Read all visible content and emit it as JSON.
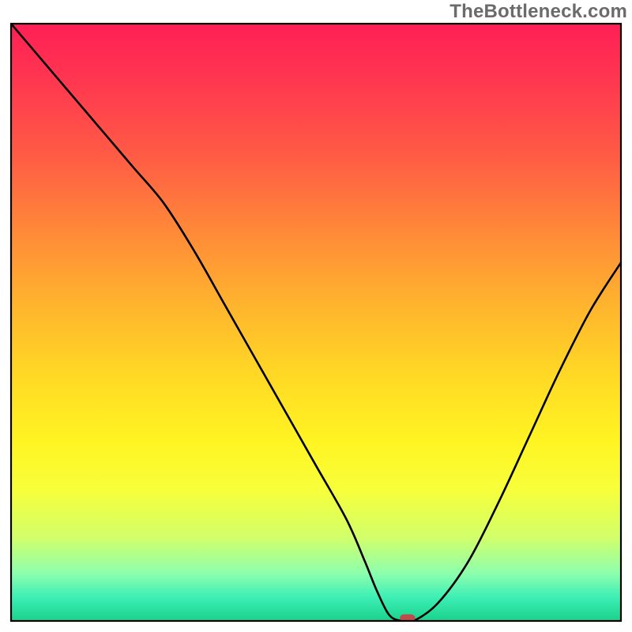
{
  "watermark": "TheBottleneck.com",
  "chart_data": {
    "type": "line",
    "title": "",
    "xlabel": "",
    "ylabel": "",
    "xlim": [
      0,
      100
    ],
    "ylim": [
      0,
      100
    ],
    "grid": false,
    "legend": false,
    "background_gradient": {
      "stops": [
        {
          "offset": 0.0,
          "color": "#ff1f55"
        },
        {
          "offset": 0.1,
          "color": "#ff3850"
        },
        {
          "offset": 0.22,
          "color": "#ff5b45"
        },
        {
          "offset": 0.35,
          "color": "#ff8a38"
        },
        {
          "offset": 0.48,
          "color": "#ffb72d"
        },
        {
          "offset": 0.6,
          "color": "#ffdc24"
        },
        {
          "offset": 0.7,
          "color": "#fff423"
        },
        {
          "offset": 0.78,
          "color": "#f7ff3a"
        },
        {
          "offset": 0.86,
          "color": "#d2ff6a"
        },
        {
          "offset": 0.92,
          "color": "#8dffad"
        },
        {
          "offset": 0.96,
          "color": "#3eefb5"
        },
        {
          "offset": 1.0,
          "color": "#19d28c"
        }
      ]
    },
    "series": [
      {
        "name": "bottleneck-curve",
        "x": [
          0,
          5,
          10,
          15,
          20,
          25,
          30,
          35,
          40,
          45,
          50,
          55,
          58,
          60,
          62,
          64,
          66,
          70,
          75,
          80,
          85,
          90,
          95,
          100
        ],
        "y": [
          100,
          94,
          88,
          82,
          76,
          70,
          62,
          53,
          44,
          35,
          26,
          17,
          10,
          5,
          1,
          0,
          0,
          3,
          10,
          20,
          31,
          42,
          52,
          60
        ]
      }
    ],
    "marker": {
      "name": "optimal-point",
      "x": 65,
      "y": 0.5,
      "color": "#c14a4a",
      "shape": "rounded-rect",
      "width_frac": 0.025,
      "height_frac": 0.012
    },
    "frame": {
      "stroke": "#000000",
      "stroke_width": 2.2
    },
    "line_style": {
      "stroke": "#000000",
      "stroke_width": 2.6
    }
  }
}
